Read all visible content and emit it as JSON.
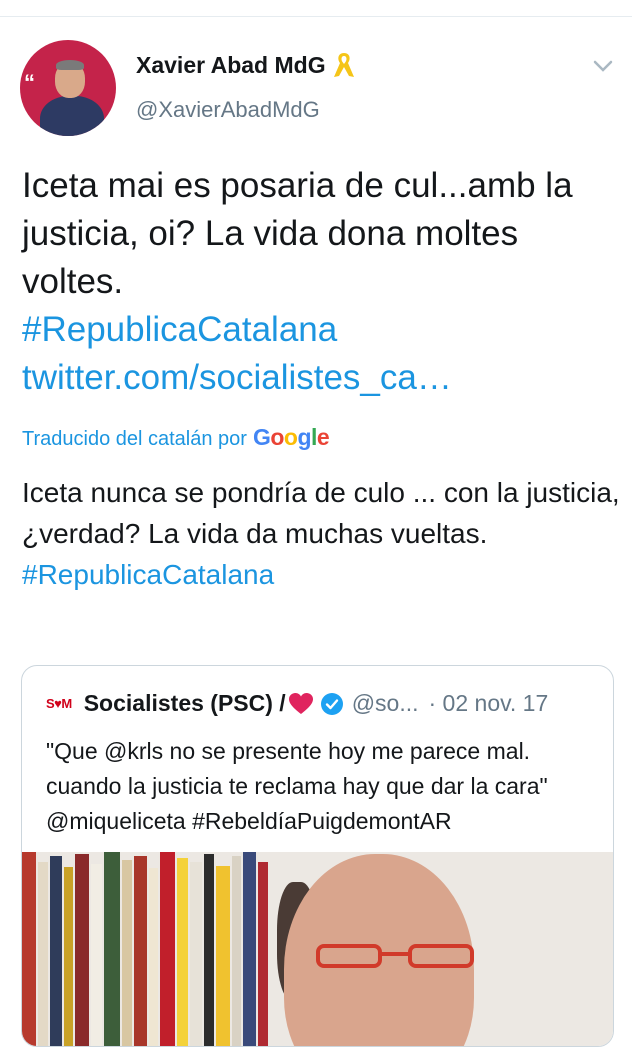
{
  "author": {
    "display_name": "Xavier Abad MdG",
    "handle": "@XavierAbadMdG",
    "avatar_icon": "profile-photo",
    "badge_icon": "yellow-ribbon-icon"
  },
  "tweet": {
    "text_main": "Iceta mai es posaria de cul...amb la justicia, oi? La vida dona moltes voltes.",
    "hashtag": "#RepublicaCatalana",
    "link": "twitter.com/socialistes_ca…"
  },
  "translation": {
    "label": "Traducido del catalán por",
    "provider": "Google",
    "text": "Iceta nunca se pondría de culo ... con la justicia, ¿verdad? La vida da muchas vueltas.",
    "hashtag": "#RepublicaCatalana"
  },
  "quoted_tweet": {
    "logo_text": "S♥M",
    "display_name": "Socialistes (PSC) /",
    "handle": "@so...",
    "date": "· 02 nov. 17",
    "text": "\"Que @krls no se presente hoy me parece mal. cuando la justicia te reclama hay que dar la cara\" @miqueliceta #RebeldíaPuigdemontAR"
  },
  "colors": {
    "link_blue": "#1b95e0",
    "secondary_gray": "#657786",
    "verified_blue": "#1da1f2",
    "heart_red": "#e0245e",
    "ribbon_yellow": "#f5c518"
  }
}
